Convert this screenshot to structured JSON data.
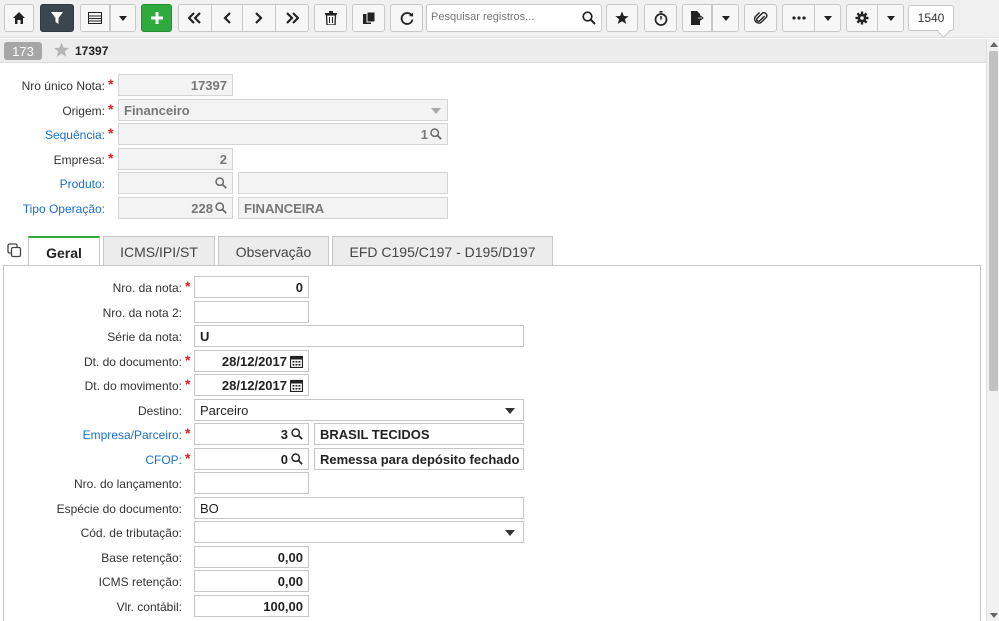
{
  "toolbar": {
    "search_placeholder": "Pesquisar registros...",
    "counter": "1540"
  },
  "record": {
    "badge": "173",
    "label": "17397"
  },
  "header": {
    "nro_unico_label": "Nro único Nota:",
    "nro_unico_value": "17397",
    "origem_label": "Origem:",
    "origem_value": "Financeiro",
    "sequencia_label": "Sequência:",
    "sequencia_value": "1",
    "empresa_label": "Empresa:",
    "empresa_value": "2",
    "produto_label": "Produto:",
    "produto_value": "",
    "produto_desc": "",
    "tipo_operacao_label": "Tipo Operação:",
    "tipo_operacao_value": "228",
    "tipo_operacao_desc": "FINANCEIRA"
  },
  "tabs": [
    "Geral",
    "ICMS/IPI/ST",
    "Observação",
    "EFD C195/C197 - D195/D197"
  ],
  "geral": {
    "nro_nota_label": "Nro. da nota:",
    "nro_nota_value": "0",
    "nro_nota2_label": "Nro. da nota 2:",
    "nro_nota2_value": "",
    "serie_label": "Série da nota:",
    "serie_value": "U",
    "dt_documento_label": "Dt. do documento:",
    "dt_documento_value": "28/12/2017",
    "dt_movimento_label": "Dt. do movimento:",
    "dt_movimento_value": "28/12/2017",
    "destino_label": "Destino:",
    "destino_value": "Parceiro",
    "empresa_parceiro_label": "Empresa/Parceiro:",
    "empresa_parceiro_value": "3",
    "empresa_parceiro_desc": "BRASIL TECIDOS",
    "cfop_label": "CFOP:",
    "cfop_value": "0",
    "cfop_desc": "Remessa para depósito fechado",
    "nro_lancamento_label": "Nro. do lançamento:",
    "nro_lancamento_value": "",
    "especie_label": "Espécie do documento:",
    "especie_value": "BO",
    "cod_tributacao_label": "Cód. de tributação:",
    "cod_tributacao_value": "",
    "base_retencao_label": "Base retenção:",
    "base_retencao_value": "0,00",
    "icms_retencao_label": "ICMS retenção:",
    "icms_retencao_value": "0,00",
    "vlr_contabil_label": "Vlr. contábil:",
    "vlr_contabil_value": "100,00"
  }
}
